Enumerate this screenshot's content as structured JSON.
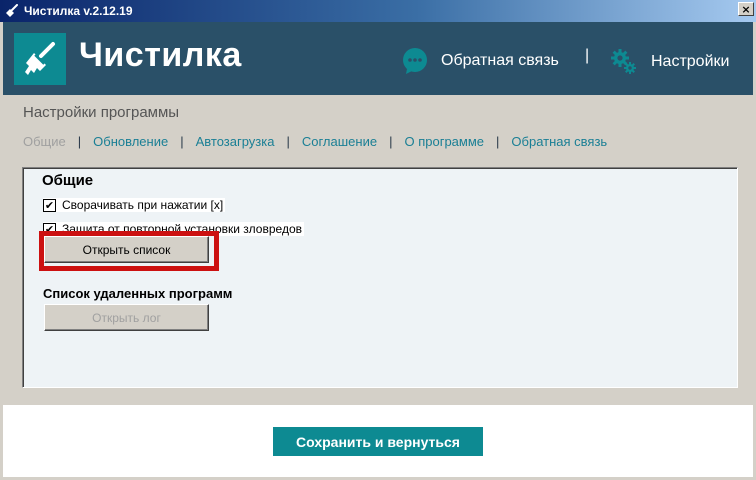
{
  "window": {
    "title": "Чистилка v.2.12.19",
    "close_glyph": "×"
  },
  "header": {
    "app_name": "Чистилка",
    "logo_icon": "broom-icon",
    "feedback_label": "Обратная связь",
    "feedback_icon": "chat-bubble-icon",
    "separator": "|",
    "settings_label": "Настройки",
    "settings_icon": "gears-icon",
    "colors": {
      "background": "#2a5068",
      "accent": "#0d8a92"
    }
  },
  "page": {
    "title": "Настройки программы",
    "tabs": [
      {
        "label": "Общие",
        "active": true
      },
      {
        "label": "Обновление",
        "active": false
      },
      {
        "label": "Автозагрузка",
        "active": false
      },
      {
        "label": "Соглашение",
        "active": false
      },
      {
        "label": "О программе",
        "active": false
      },
      {
        "label": "Обратная связь",
        "active": false
      }
    ],
    "tab_separator": "|"
  },
  "general": {
    "title": "Общие",
    "checkbox_minimize": {
      "label": "Сворачивать при нажатии [x]",
      "checked": true
    },
    "checkbox_protection": {
      "label": "Защита от повторной установки зловредов",
      "checked": true
    },
    "open_list_button": "Открыть список",
    "removed_programs_label": "Список удаленных программ",
    "open_log_button": "Открыть лог",
    "highlight_color": "#cc1111"
  },
  "footer": {
    "save_button": "Сохранить и вернуться"
  }
}
